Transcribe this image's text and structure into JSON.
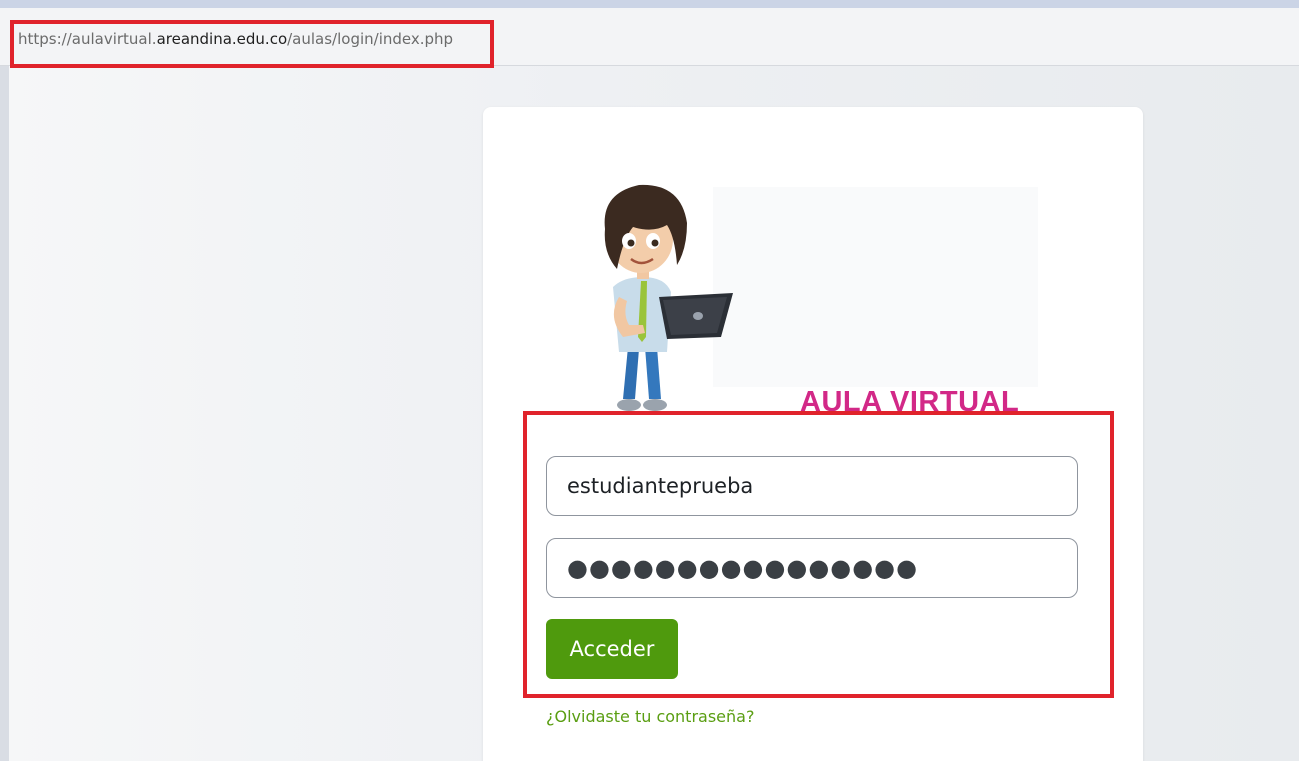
{
  "browser": {
    "url_prefix": "https://aulavirtual.",
    "url_domain": "areandina.edu.co",
    "url_path": "/aulas/login/index.php"
  },
  "login": {
    "brand_text": "AULA VIRTUAL",
    "username_value": "estudianteprueba",
    "password_mask": "●●●●●●●●●●●●●●●●",
    "submit_label": "Acceder",
    "forgot_password_label": "¿Olvidaste tu contraseña?"
  },
  "colors": {
    "brand_magenta": "#d22887",
    "button_green": "#4f9a0d",
    "link_green": "#5a9e12",
    "callout_red": "#e0232b"
  },
  "icons": {
    "mascot": "student-with-laptop-illustration"
  }
}
